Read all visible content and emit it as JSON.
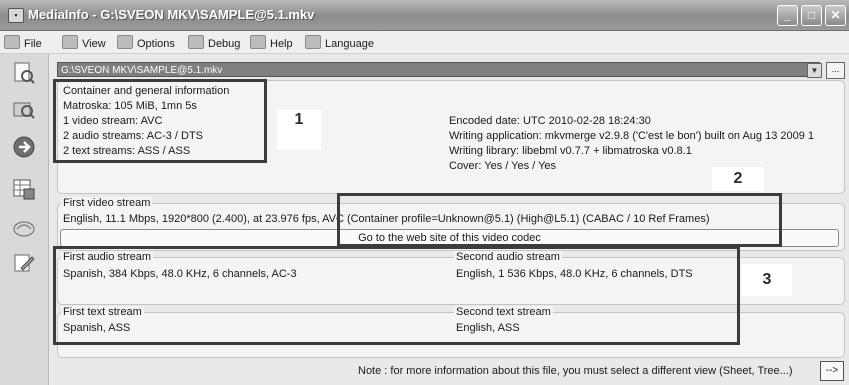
{
  "window": {
    "title": "MediaInfo - G:\\SVEON MKV\\SAMPLE@5.1.mkv",
    "minimize": "_",
    "maximize": "□",
    "close": "✕"
  },
  "menu": [
    {
      "label": "File",
      "icon": "file-icon"
    },
    {
      "label": "View",
      "icon": "view-icon"
    },
    {
      "label": "Options",
      "icon": "options-icon"
    },
    {
      "label": "Debug",
      "icon": "debug-icon"
    },
    {
      "label": "Help",
      "icon": "help-icon"
    },
    {
      "label": "Language",
      "icon": "language-icon"
    }
  ],
  "sidebar": [
    "open-file-icon",
    "open-folder-icon",
    "export-icon",
    "sheet-icon",
    "about-icon",
    "edit-icon"
  ],
  "path": {
    "value": "G:\\SVEON MKV\\SAMPLE@5.1.mkv",
    "more_label": "..."
  },
  "general": {
    "title": "Container and general information",
    "lines": [
      "Matroska: 105 MiB, 1mn 5s",
      "1 video stream: AVC",
      "2 audio streams: AC-3 / DTS",
      "2 text streams: ASS / ASS"
    ],
    "right_lines": [
      "Encoded date: UTC 2010-02-28 18:24:30",
      "Writing application: mkvmerge v2.9.8 ('C'est le bon') built on Aug 13 2009 1",
      "Writing library: libebml v0.7.7 + libmatroska v0.8.1",
      "Cover: Yes / Yes / Yes"
    ]
  },
  "video": {
    "title": "First video stream",
    "info": "English, 11.1 Mbps, 1920*800 (2.400), at 23.976 fps, AVC (Container profile=Unknown@5.1) (High@L5.1) (CABAC / 10 Ref Frames)",
    "codec_button": "Go to the web site of this video codec"
  },
  "audio": [
    {
      "title": "First audio stream",
      "info": "Spanish, 384 Kbps, 48.0 KHz, 6 channels, AC-3"
    },
    {
      "title": "Second audio stream",
      "info": "English, 1 536 Kbps, 48.0 KHz, 6 channels, DTS"
    }
  ],
  "text": [
    {
      "title": "First text stream",
      "info": "Spanish, ASS"
    },
    {
      "title": "Second text stream",
      "info": "English, ASS"
    }
  ],
  "annotations": [
    "1",
    "2",
    "3"
  ],
  "note": {
    "text": "Note : for more information about this file, you must select a different view (Sheet, Tree...)",
    "button": "-->"
  }
}
